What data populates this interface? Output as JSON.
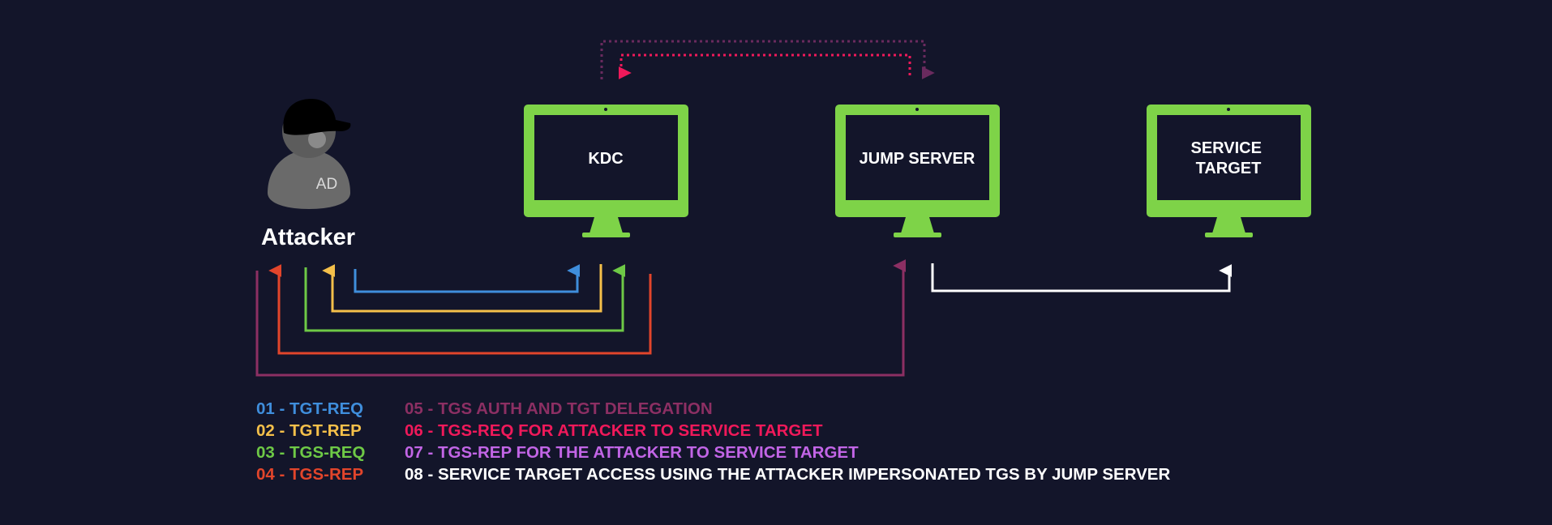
{
  "nodes": {
    "attacker": {
      "label": "Attacker",
      "badge": "AD"
    },
    "kdc": {
      "label": "KDC"
    },
    "jump_server": {
      "label": "JUMP SERVER"
    },
    "service_target": {
      "lines": [
        "SERVICE",
        "TARGET"
      ]
    }
  },
  "colors": {
    "background": "#13152a",
    "monitor": "#7ed348",
    "screen": "#13152a",
    "attacker_body": "#6a6a6a",
    "attacker_head": "#5c5c5c",
    "cap": "#000000",
    "step01": "#3f8edc",
    "step02": "#f5c04a",
    "step03": "#6ec946",
    "step04": "#e2452b",
    "step05": "#8c2f63",
    "step06": "#f0195a",
    "step07": "#c265e6",
    "step08": "#ffffff",
    "delegation_dotted": "#6a2a5e"
  },
  "legend": {
    "left": [
      {
        "text": "01 - TGT-REQ",
        "color": "#3f8edc"
      },
      {
        "text": "02 - TGT-REP",
        "color": "#f5c04a"
      },
      {
        "text": "03 - TGS-REQ",
        "color": "#6ec946"
      },
      {
        "text": "04 - TGS-REP",
        "color": "#e2452b"
      }
    ],
    "right": [
      {
        "text": "05 - TGS AUTH AND TGT DELEGATION",
        "color": "#8c2f63"
      },
      {
        "text": "06 - TGS-REQ FOR ATTACKER TO SERVICE TARGET",
        "color": "#f0195a"
      },
      {
        "text": "07 - TGS-REP FOR THE ATTACKER TO SERVICE TARGET",
        "color": "#c265e6"
      },
      {
        "text": "08 - SERVICE TARGET ACCESS USING THE ATTACKER IMPERSONATED TGS BY JUMP SERVER",
        "color": "#ffffff"
      }
    ]
  }
}
